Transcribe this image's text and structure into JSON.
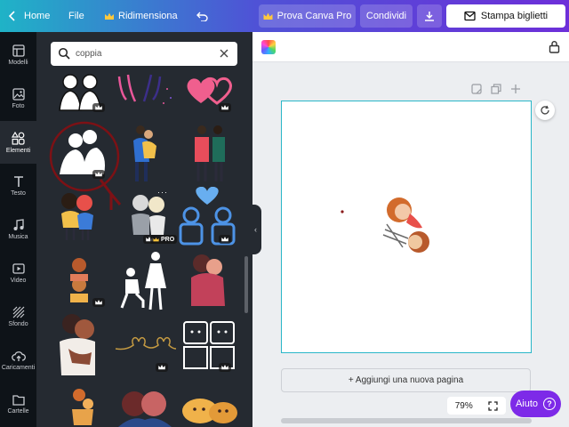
{
  "topbar": {
    "home_label": "Home",
    "file_label": "File",
    "resize_label": "Ridimensiona",
    "pro_label": "Prova Canva Pro",
    "share_label": "Condividi",
    "print_label": "Stampa biglietti"
  },
  "rail": {
    "items": [
      {
        "label": "Modelli",
        "icon": "templates-icon"
      },
      {
        "label": "Foto",
        "icon": "photo-icon"
      },
      {
        "label": "Elementi",
        "icon": "elements-icon"
      },
      {
        "label": "Testo",
        "icon": "text-icon"
      },
      {
        "label": "Musica",
        "icon": "music-icon"
      },
      {
        "label": "Video",
        "icon": "video-icon"
      },
      {
        "label": "Sfondo",
        "icon": "background-icon"
      },
      {
        "label": "Caricamenti",
        "icon": "upload-icon"
      },
      {
        "label": "Cartelle",
        "icon": "folder-icon"
      }
    ]
  },
  "search": {
    "value": "coppia"
  },
  "panel": {
    "pro_badge": "PRO"
  },
  "canvas": {
    "add_page_label": "+ Aggiungi una nuova pagina",
    "zoom": "79%",
    "help_label": "Aiuto",
    "help_icon": "?"
  },
  "colors": {
    "accent": "#7d2ae8",
    "selection": "#29b6c8",
    "rail_bg": "#0e1318",
    "panel_bg": "#252a31"
  }
}
